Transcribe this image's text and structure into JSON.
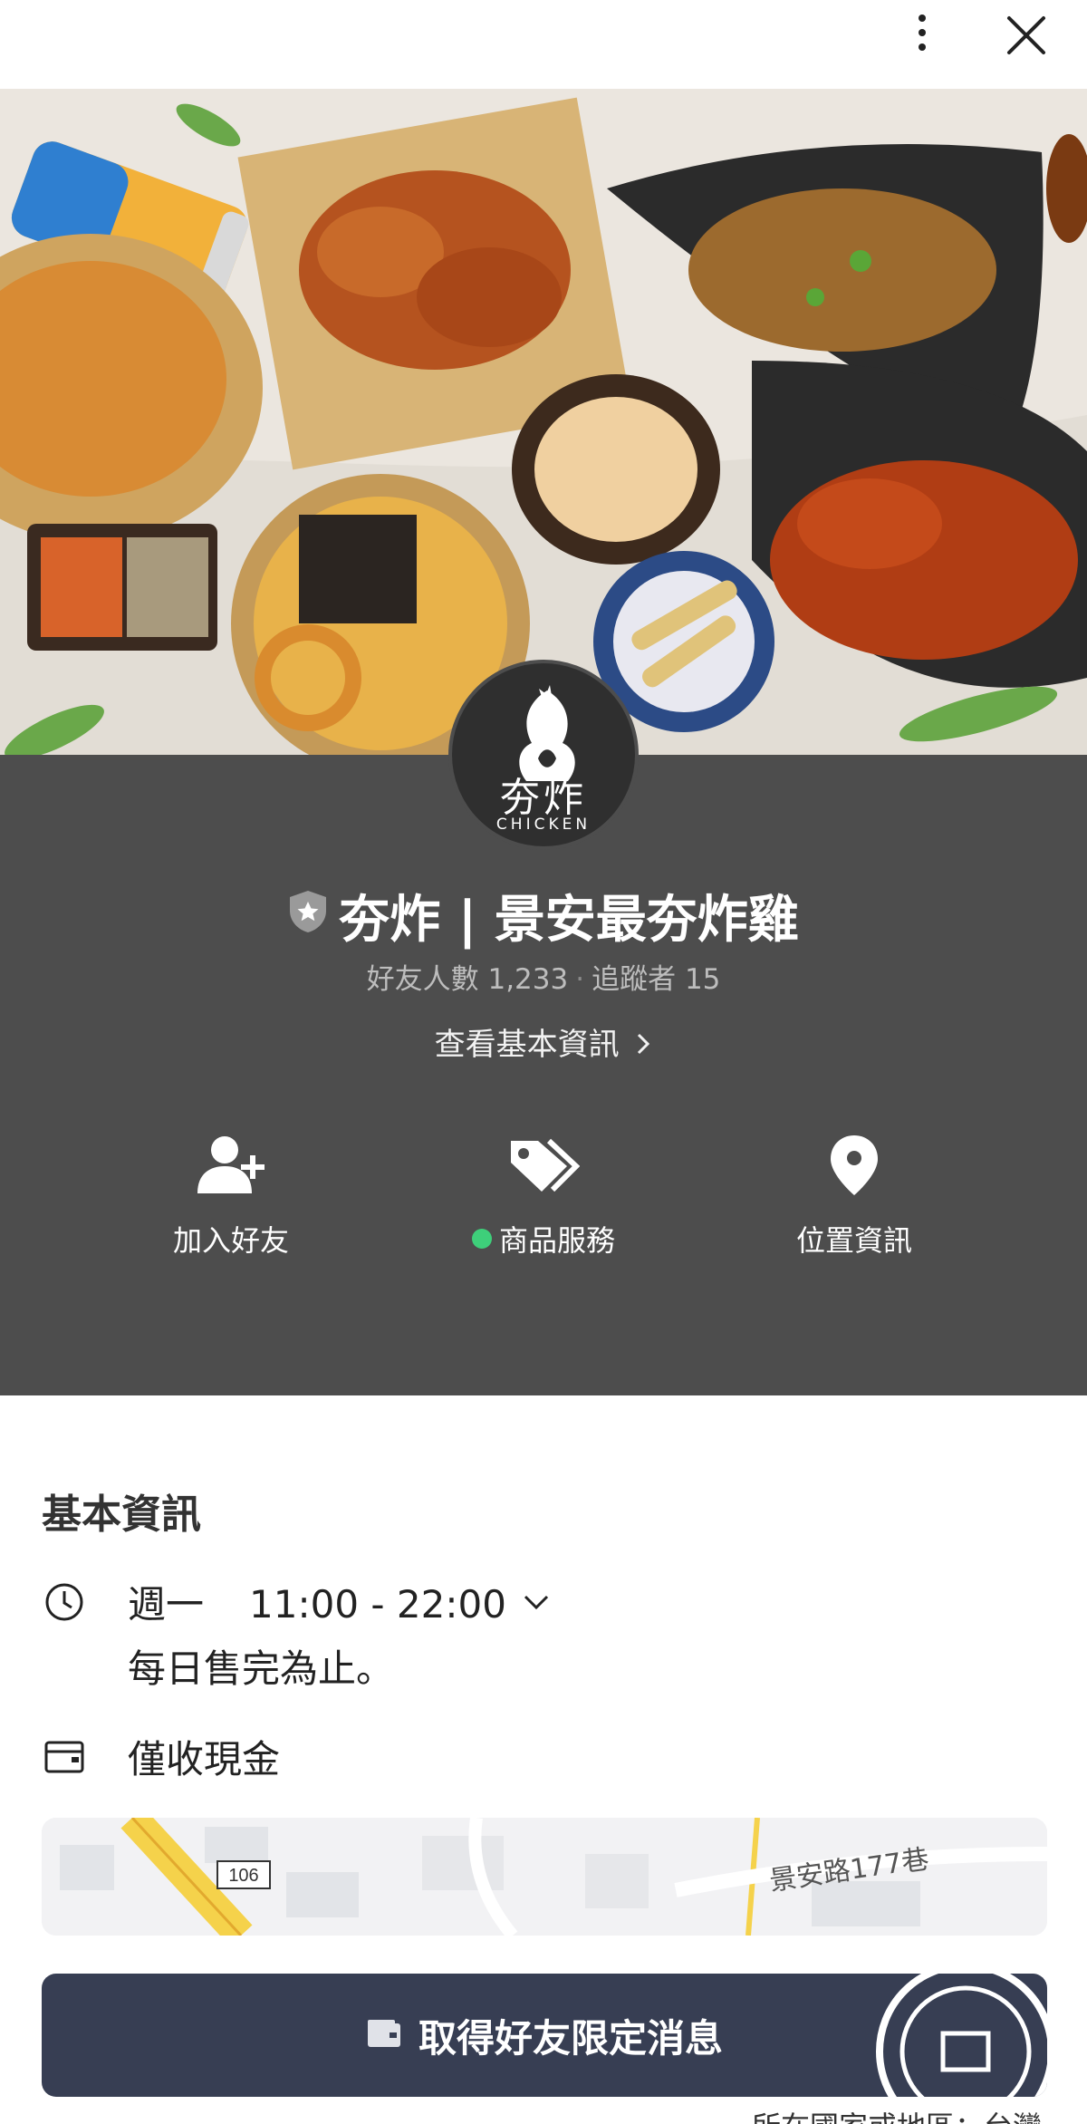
{
  "topbar": {
    "more_icon": "more-vertical-icon",
    "close_icon": "close-icon"
  },
  "hero": {
    "description_icon": "fried-chicken-photo"
  },
  "profile": {
    "logo_cn": "夯炸",
    "logo_en": "CHICKEN",
    "badge_icon": "verified-shield-icon",
    "name": "夯炸 | 景安最夯炸雞",
    "friends_label": "好友人數",
    "friends_count": "1,233",
    "followers_label": "追蹤者",
    "followers_count": "15",
    "info_link": "查看基本資訊"
  },
  "actions": [
    {
      "icon": "add-friend-icon",
      "label": "加入好友"
    },
    {
      "icon": "tag-icon",
      "label": "商品服務",
      "status_color": "#3ecf7a"
    },
    {
      "icon": "location-pin-icon",
      "label": "位置資訊"
    }
  ],
  "basic_info": {
    "title": "基本資訊",
    "hours_day": "週一",
    "hours_time": "11:00 - 22:00",
    "hours_note": "每日售完為止。",
    "payment": "僅收現金"
  },
  "map": {
    "road_number": "106",
    "street_label": "景安路177巷"
  },
  "cta": {
    "label": "取得好友限定消息"
  },
  "footer": {
    "region_text": "所在國家或地區：台灣"
  },
  "colors": {
    "profile_bg": "#4d4d4d",
    "cta_bg": "#373e53",
    "status_green": "#3ecf7a"
  }
}
